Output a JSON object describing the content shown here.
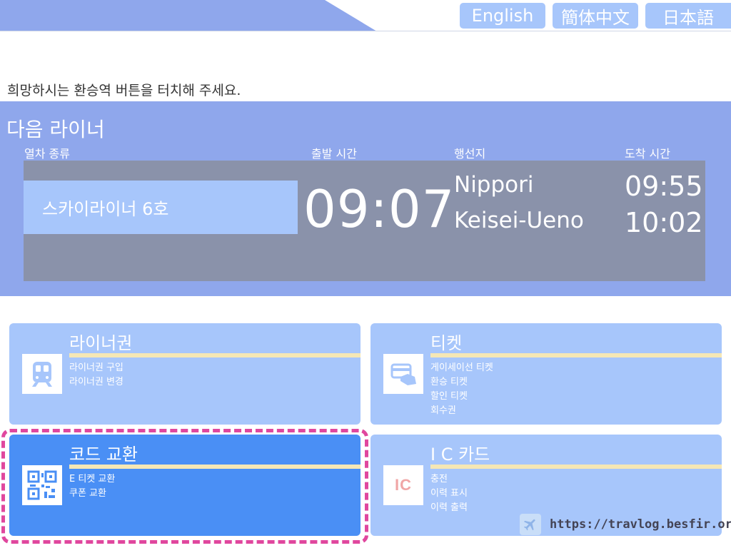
{
  "colors": {
    "accent": "#8fa7ec",
    "button": "#a7c6fb",
    "selected_card": "#4a8ff5",
    "board": "#8a92aa",
    "rule": "#f5e7b5",
    "highlight": "#e0479e"
  },
  "languages": [
    {
      "label": "English"
    },
    {
      "label": "簡体中文"
    },
    {
      "label": "日本語"
    }
  ],
  "instruction": "희망하시는 환승역 버튼을 터치해 주세요.",
  "next_liner": {
    "title": "다음 라이너",
    "headers": {
      "train_type": "열차 종류",
      "departure": "출발 시간",
      "destination": "행선지",
      "arrival": "도착 시간"
    },
    "train_name": "스카이라이너 6호",
    "departure_time": "09:07",
    "stops": [
      {
        "destination": "Nippori",
        "arrival": "09:55"
      },
      {
        "destination": "Keisei-Ueno",
        "arrival": "10:02"
      }
    ]
  },
  "menu": {
    "liner": {
      "title": "라이너권",
      "icon": "train-icon",
      "items": [
        "라이너권 구입",
        "라이너권 변경"
      ]
    },
    "ticket": {
      "title": "티켓",
      "icon": "ticket-hand-icon",
      "items": [
        "게이세이선 티켓",
        "환승 티켓",
        "할인 티켓",
        "회수권"
      ]
    },
    "code": {
      "title": "코드 교환",
      "icon": "qr-code-icon",
      "items": [
        "E 티켓 교환",
        "쿠폰 교환"
      ]
    },
    "ic": {
      "title": "I C 카드",
      "icon": "ic-card-icon",
      "icon_text": "IC",
      "items": [
        "충전",
        "이력 표시",
        "이력 출력"
      ]
    }
  },
  "watermark": {
    "icon": "airplane-icon",
    "text": "https://travlog.besfir.org/"
  }
}
